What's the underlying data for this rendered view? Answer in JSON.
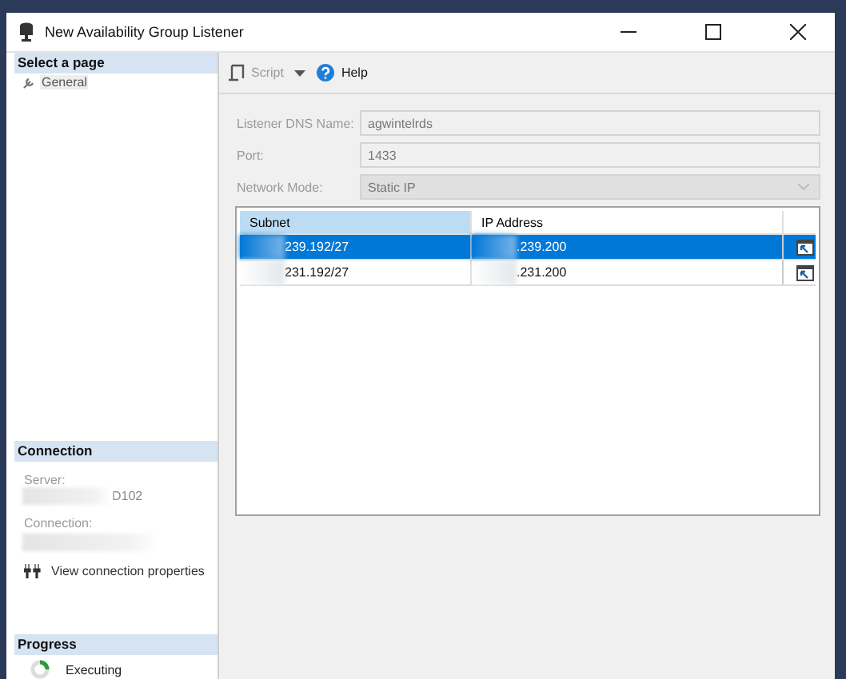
{
  "window": {
    "title": "New Availability Group Listener"
  },
  "sidebar": {
    "select_page": {
      "header": "Select a page",
      "items": [
        {
          "label": "General",
          "selected": true
        }
      ]
    },
    "connection": {
      "header": "Connection",
      "server_label": "Server:",
      "server_value": "D102",
      "connection_label": "Connection:",
      "link": "View connection properties"
    },
    "progress": {
      "header": "Progress",
      "status": "Executing"
    }
  },
  "toolbar": {
    "script": {
      "label": "Script",
      "disabled": true
    },
    "help": {
      "label": "Help"
    }
  },
  "form": {
    "fields": [
      {
        "label": "Listener DNS Name:",
        "value": "agwintelrds",
        "kind": "text",
        "disabled": true
      },
      {
        "label": "Port:",
        "value": "1433",
        "kind": "text",
        "disabled": true
      },
      {
        "label": "Network Mode:",
        "value": "Static IP",
        "kind": "dropdown",
        "disabled": true
      }
    ]
  },
  "table": {
    "columns": [
      {
        "label": "Subnet",
        "selected": true
      },
      {
        "label": "IP Address",
        "selected": false
      }
    ],
    "rows": [
      {
        "subnet": "239.192/27",
        "ip_address": ".239.200",
        "selected": true
      },
      {
        "subnet": "231.192/27",
        "ip_address": ".231.200",
        "selected": false
      }
    ]
  }
}
